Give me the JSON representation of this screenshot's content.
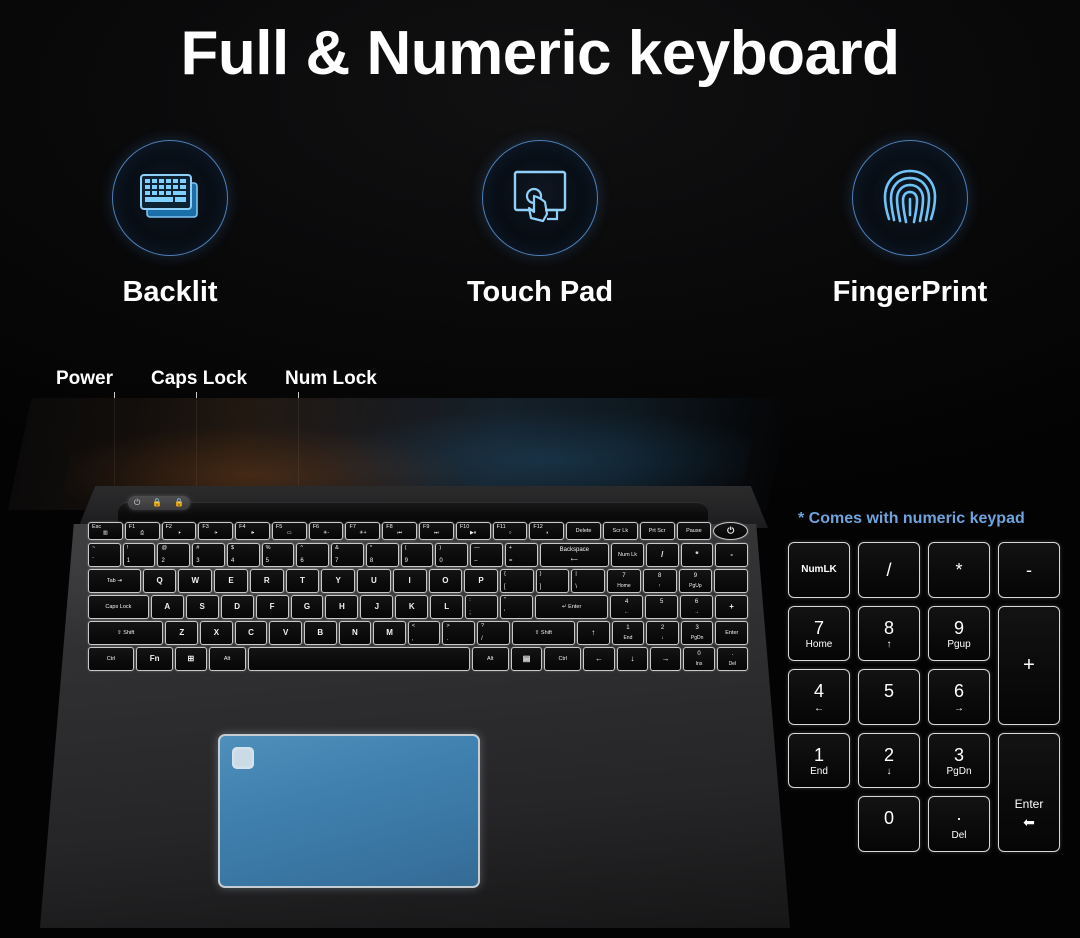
{
  "headline": "Full & Numeric keyboard",
  "features": [
    {
      "label": "Backlit",
      "icon": "backlit-keyboard-icon"
    },
    {
      "label": "Touch Pad",
      "icon": "touchpad-icon"
    },
    {
      "label": "FingerPrint",
      "icon": "fingerprint-icon"
    }
  ],
  "callouts": [
    {
      "label": "Power"
    },
    {
      "label": "Caps Lock"
    },
    {
      "label": "Num Lock"
    }
  ],
  "numpad_note": "* Comes with numeric keypad",
  "keyboard": {
    "fn_row": [
      {
        "tl": "Esc",
        "sym": "▥"
      },
      {
        "tl": "F1",
        "sym": "⎙"
      },
      {
        "tl": "F2",
        "sym": "🕨"
      },
      {
        "tl": "F3",
        "sym": "🕩"
      },
      {
        "tl": "F4",
        "sym": "🕪"
      },
      {
        "tl": "F5",
        "sym": "▭"
      },
      {
        "tl": "F6",
        "sym": "☀-"
      },
      {
        "tl": "F7",
        "sym": "☀+"
      },
      {
        "tl": "F8",
        "sym": "⏮"
      },
      {
        "tl": "F9",
        "sym": "⏭"
      },
      {
        "tl": "F10",
        "sym": "▶⏸"
      },
      {
        "tl": "F11",
        "sym": "○"
      },
      {
        "tl": "F12",
        "sym": "◑"
      },
      {
        "label": "Delete"
      },
      {
        "label": "Scr Lk"
      },
      {
        "label": "Prt Scr"
      },
      {
        "label": "Pause"
      },
      {
        "label": "⏻",
        "power": true
      }
    ],
    "number_row": [
      {
        "top": "~",
        "bottom": "`"
      },
      {
        "top": "!",
        "bottom": "1"
      },
      {
        "top": "@",
        "bottom": "2"
      },
      {
        "top": "#",
        "bottom": "3"
      },
      {
        "top": "$",
        "bottom": "4"
      },
      {
        "top": "%",
        "bottom": "5"
      },
      {
        "top": "^",
        "bottom": "6"
      },
      {
        "top": "&",
        "bottom": "7"
      },
      {
        "top": "*",
        "bottom": "8"
      },
      {
        "top": "(",
        "bottom": "9"
      },
      {
        "top": ")",
        "bottom": "0"
      },
      {
        "top": "—",
        "bottom": "–"
      },
      {
        "top": "+",
        "bottom": "="
      },
      {
        "label": "Backspace",
        "sub": "⟵",
        "wide": 2.2
      },
      {
        "label": "Num Lk"
      },
      {
        "label": "/"
      },
      {
        "label": "*"
      },
      {
        "label": "-"
      }
    ],
    "qwerty_row": [
      {
        "label": "Tab",
        "sym": "⇥",
        "wide": 1.6
      },
      {
        "label": "Q"
      },
      {
        "label": "W"
      },
      {
        "label": "E"
      },
      {
        "label": "R"
      },
      {
        "label": "T"
      },
      {
        "label": "Y"
      },
      {
        "label": "U"
      },
      {
        "label": "I"
      },
      {
        "label": "O"
      },
      {
        "label": "P"
      },
      {
        "top": "{",
        "bottom": "["
      },
      {
        "top": "}",
        "bottom": "]"
      },
      {
        "top": "|",
        "bottom": "\\"
      },
      {
        "main": "7",
        "sub": "Home"
      },
      {
        "main": "8",
        "sub": "↑"
      },
      {
        "main": "9",
        "sub": "PgUp"
      },
      {
        "label": ""
      }
    ],
    "asdf_row": [
      {
        "label": "Caps Lock",
        "wide": 1.9
      },
      {
        "label": "A"
      },
      {
        "label": "S"
      },
      {
        "label": "D"
      },
      {
        "label": "F"
      },
      {
        "label": "G"
      },
      {
        "label": "H"
      },
      {
        "label": "J"
      },
      {
        "label": "K"
      },
      {
        "label": "L"
      },
      {
        "top": ":",
        "bottom": ";"
      },
      {
        "top": "\"",
        "bottom": "'"
      },
      {
        "label": "↵ Enter",
        "wide": 2.3
      },
      {
        "main": "4",
        "sub": "←"
      },
      {
        "main": "5",
        "sub": ""
      },
      {
        "main": "6",
        "sub": "→"
      },
      {
        "label": "+",
        "tallPlus": true
      }
    ],
    "zxcv_row": [
      {
        "label": "⇧ Shift",
        "wide": 2.4
      },
      {
        "label": "Z"
      },
      {
        "label": "X"
      },
      {
        "label": "C"
      },
      {
        "label": "V"
      },
      {
        "label": "B"
      },
      {
        "label": "N"
      },
      {
        "label": "M"
      },
      {
        "top": "<",
        "bottom": ","
      },
      {
        "top": ">",
        "bottom": "."
      },
      {
        "top": "?",
        "bottom": "/"
      },
      {
        "label": "⇧ Shift",
        "wide": 2.0
      },
      {
        "label": "↑"
      },
      {
        "main": "1",
        "sub": "End"
      },
      {
        "main": "2",
        "sub": "↓"
      },
      {
        "main": "3",
        "sub": "PgDn"
      },
      {
        "label": "Enter",
        "wide": 1.0
      }
    ],
    "bottom_row": [
      {
        "label": "Ctrl",
        "wide": 1.5
      },
      {
        "label": "Fn",
        "wide": 1.2
      },
      {
        "label": "⊞",
        "wide": 1.0
      },
      {
        "label": "Alt",
        "wide": 1.2
      },
      {
        "label": "",
        "wide": 7.5
      },
      {
        "label": "Alt",
        "wide": 1.2
      },
      {
        "label": "▤",
        "wide": 1.0
      },
      {
        "label": "Ctrl",
        "wide": 1.2
      },
      {
        "label": "←"
      },
      {
        "label": "↓"
      },
      {
        "label": "→"
      },
      {
        "main": "0",
        "sub": "Ins"
      },
      {
        "main": ".",
        "sub": "Del"
      }
    ]
  },
  "numpad": [
    {
      "label": "NumLK",
      "type": "lbl"
    },
    {
      "label": "/",
      "type": "only"
    },
    {
      "label": "*",
      "type": "only"
    },
    {
      "label": "-",
      "type": "only"
    },
    {
      "main": "7",
      "sub": "Home",
      "type": "dual"
    },
    {
      "main": "8",
      "sub": "↑",
      "type": "dual"
    },
    {
      "main": "9",
      "sub": "Pgup",
      "type": "dual"
    },
    {
      "label": "+",
      "type": "tall"
    },
    {
      "main": "4",
      "sub": "←",
      "type": "dual"
    },
    {
      "main": "5",
      "sub": "",
      "type": "dual"
    },
    {
      "main": "6",
      "sub": "→",
      "type": "dual"
    },
    {
      "main": "1",
      "sub": "End",
      "type": "dual"
    },
    {
      "main": "2",
      "sub": "↓",
      "type": "dual"
    },
    {
      "main": "3",
      "sub": "PgDn",
      "type": "dual"
    },
    {
      "label": "Enter",
      "type": "enter",
      "arrow": "⬅"
    },
    {
      "label": "",
      "type": "blank"
    },
    {
      "main": "0",
      "sub": "",
      "type": "dual"
    },
    {
      "main": "·",
      "sub": "Del",
      "type": "dual"
    }
  ],
  "colors": {
    "background": "#040404",
    "accent_blue": "#6ea3dd",
    "touchpad": "#4081b0",
    "icon_blue": "#5aa8e8",
    "text": "#ffffff"
  }
}
